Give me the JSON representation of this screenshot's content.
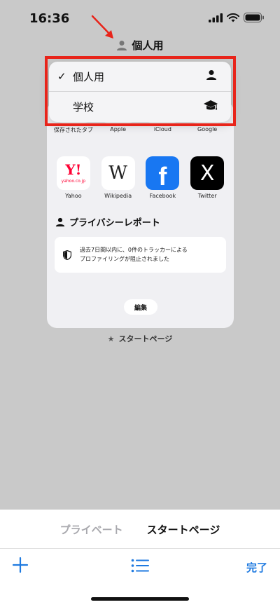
{
  "status": {
    "time": "16:36"
  },
  "profile_header": {
    "label": "個人用"
  },
  "dropdown": {
    "items": [
      {
        "label": "個人用",
        "checked": "✓",
        "icon": "person-icon"
      },
      {
        "label": "学校",
        "checked": "",
        "icon": "graduation-cap-icon"
      }
    ]
  },
  "favorites": [
    {
      "label": "保存されたタブ",
      "icon": "saved-tabs-icon"
    },
    {
      "label": "Apple",
      "icon": "apple-icon"
    },
    {
      "label": "iCloud",
      "icon": "icloud-icon"
    },
    {
      "label": "Google",
      "icon": "google-icon"
    },
    {
      "label": "Yahoo",
      "icon": "yahoo-icon",
      "logo_text": "Y!",
      "logo_sub": "yahoo.co.jp"
    },
    {
      "label": "Wikipedia",
      "icon": "wikipedia-icon",
      "logo_text": "W"
    },
    {
      "label": "Facebook",
      "icon": "facebook-icon",
      "logo_text": "f"
    },
    {
      "label": "Twitter",
      "icon": "x-icon",
      "logo_text": "X"
    }
  ],
  "privacy": {
    "title": "プライバシーレポート",
    "message_line1": "過去7日間以内に、0件のトラッカーによる",
    "message_line2": "プロファイリングが阻止されました"
  },
  "edit_button": "編集",
  "start_page_caption": "スタートページ",
  "mode_tabs": {
    "private": "プライベート",
    "start": "スタートページ"
  },
  "toolbar": {
    "done": "完了"
  },
  "colors": {
    "highlight": "#e8241a",
    "accent": "#1f7ae0",
    "facebook": "#1877f2",
    "yahoo": "#ff0033"
  }
}
